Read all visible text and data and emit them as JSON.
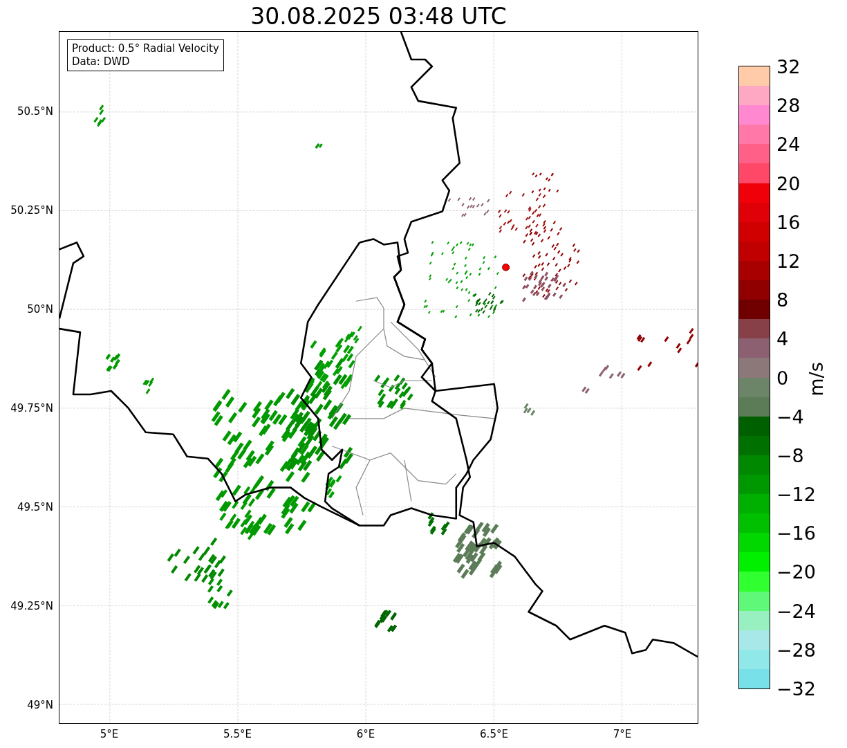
{
  "title": "30.08.2025 03:48 UTC",
  "legend": {
    "lines": [
      "Product: 0.5° Radial Velocity",
      "Data: DWD"
    ]
  },
  "map": {
    "y_ticks": [
      "50.5°N",
      "50.25°N",
      "50°N",
      "49.75°N",
      "49.5°N",
      "49.25°N",
      "49°N"
    ],
    "x_ticks": [
      "5°E",
      "5.5°E",
      "6°E",
      "6.5°E",
      "7°E"
    ]
  },
  "colorbar": {
    "label": "m/s",
    "ticks": [
      "32",
      "28",
      "24",
      "20",
      "16",
      "12",
      "8",
      "4",
      "0",
      "−4",
      "−8",
      "−12",
      "−16",
      "−20",
      "−24",
      "−28",
      "−32"
    ],
    "segments": [
      {
        "color": "#ffcba8"
      },
      {
        "color": "#ffa8c4"
      },
      {
        "color": "#ff88d0"
      },
      {
        "color": "#ff78a8"
      },
      {
        "color": "#ff6088"
      },
      {
        "color": "#ff4868"
      },
      {
        "color": "#f00008"
      },
      {
        "color": "#e00008"
      },
      {
        "color": "#d00000"
      },
      {
        "color": "#c00000"
      },
      {
        "color": "#a80000"
      },
      {
        "color": "#900000"
      },
      {
        "color": "#700000"
      },
      {
        "color": "#884048"
      },
      {
        "color": "#8c6070"
      },
      {
        "color": "#8c7878"
      },
      {
        "color": "#6c8468"
      },
      {
        "color": "#5c7c58"
      },
      {
        "color": "#006000"
      },
      {
        "color": "#007000"
      },
      {
        "color": "#008800"
      },
      {
        "color": "#009800"
      },
      {
        "color": "#00b000"
      },
      {
        "color": "#00c000"
      },
      {
        "color": "#00d800"
      },
      {
        "color": "#00f000"
      },
      {
        "color": "#30ff30"
      },
      {
        "color": "#60f878"
      },
      {
        "color": "#98f0c0"
      },
      {
        "color": "#a8e8e8"
      },
      {
        "color": "#90e8e8"
      },
      {
        "color": "#78e0e8"
      }
    ]
  }
}
